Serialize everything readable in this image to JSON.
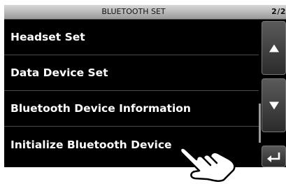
{
  "header": {
    "title": "BLUETOOTH SET",
    "page": "2/2"
  },
  "menu": {
    "items": [
      {
        "label": "Headset Set"
      },
      {
        "label": "Data Device Set"
      },
      {
        "label": "Bluetooth Device Information"
      },
      {
        "label": "Initialize Bluetooth Device"
      }
    ]
  },
  "nav": {
    "up_icon": "triangle-up-icon",
    "down_icon": "triangle-down-icon",
    "back_icon": "return-arrow-icon"
  },
  "overlay": {
    "icon": "pointing-hand-icon"
  }
}
